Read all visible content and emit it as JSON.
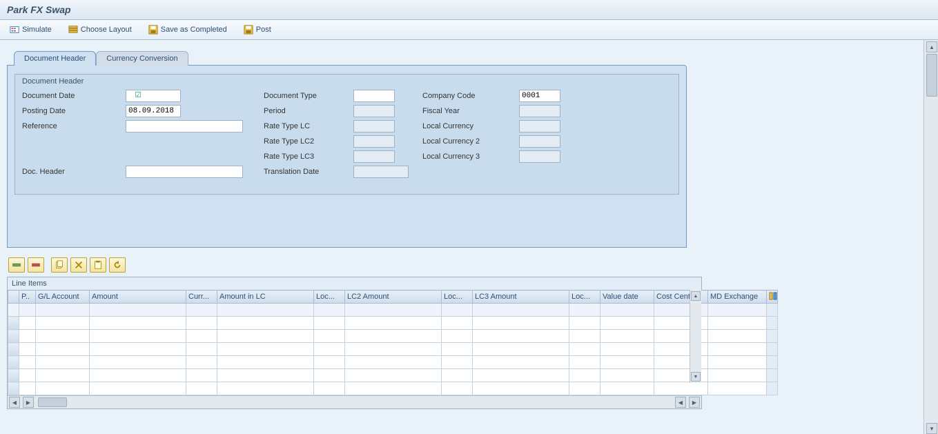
{
  "title": "Park FX Swap",
  "toolbar": {
    "simulate": "Simulate",
    "choose_layout": "Choose Layout",
    "save_completed": "Save as Completed",
    "post": "Post"
  },
  "tabs": {
    "doc_header": "Document Header",
    "currency_conv": "Currency Conversion"
  },
  "group": {
    "title": "Document Header",
    "fields": {
      "document_date_lbl": "Document Date",
      "document_date_val": "",
      "posting_date_lbl": "Posting Date",
      "posting_date_val": "08.09.2018",
      "reference_lbl": "Reference",
      "reference_val": "",
      "doc_header_lbl": "Doc. Header",
      "doc_header_val": "",
      "document_type_lbl": "Document Type",
      "document_type_val": "",
      "period_lbl": "Period",
      "period_val": "",
      "rate_lc_lbl": "Rate Type LC",
      "rate_lc_val": "",
      "rate_lc2_lbl": "Rate Type LC2",
      "rate_lc2_val": "",
      "rate_lc3_lbl": "Rate Type LC3",
      "rate_lc3_val": "",
      "translation_date_lbl": "Translation Date",
      "translation_date_val": "",
      "company_code_lbl": "Company Code",
      "company_code_val": "0001",
      "fiscal_year_lbl": "Fiscal Year",
      "fiscal_year_val": "",
      "local_curr_lbl": "Local Currency",
      "local_curr_val": "",
      "local_curr2_lbl": "Local Currency 2",
      "local_curr2_val": "",
      "local_curr3_lbl": "Local Currency 3",
      "local_curr3_val": ""
    }
  },
  "table": {
    "title": "Line Items",
    "columns": [
      "P..",
      "G/L Account",
      "Amount",
      "Curr...",
      "Amount in LC",
      "Loc...",
      "LC2 Amount",
      "Loc...",
      "LC3 Amount",
      "Loc...",
      "Value date",
      "Cost Center",
      "MD Exchange"
    ],
    "rows": 7
  }
}
